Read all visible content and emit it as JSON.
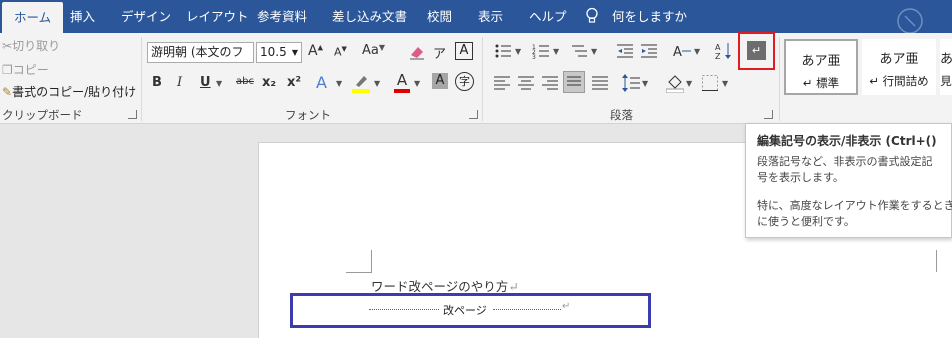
{
  "tabs": [
    {
      "label": "ホーム",
      "active": true
    },
    {
      "label": "挿入"
    },
    {
      "label": "デザイン"
    },
    {
      "label": "レイアウト"
    },
    {
      "label": "参考資料"
    },
    {
      "label": "差し込み文書"
    },
    {
      "label": "校閲"
    },
    {
      "label": "表示"
    },
    {
      "label": "ヘルプ"
    }
  ],
  "tell_me": "何をしますか",
  "clipboard": {
    "cut": "切り取り",
    "copy": "コピー",
    "format_painter": "書式のコピー/貼り付け",
    "label": "クリップボード"
  },
  "font": {
    "name": "游明朝 (本文のフォ",
    "size": "10.5",
    "change_case": "Aa",
    "label": "フォント",
    "bold": "B",
    "italic": "I",
    "underline": "U",
    "strike": "abc",
    "sub": "x₂",
    "sup": "x²",
    "grow": "A",
    "shrink": "A",
    "effects": "A",
    "color": "A",
    "shade": "A",
    "border": "A",
    "enclose": "字"
  },
  "paragraph": {
    "label": "段落",
    "show_marks_symbol": "↵"
  },
  "styles": [
    {
      "preview": "あア亜",
      "name": "↵ 標準"
    },
    {
      "preview": "あア亜",
      "name": "↵ 行間詰め"
    },
    {
      "preview": "あ",
      "name": "見"
    }
  ],
  "tooltip": {
    "title": "編集記号の表示/非表示 (Ctrl+()",
    "line1": "段落記号など、非表示の書式設定記",
    "line2": "号を表示します。",
    "line3": "特に、高度なレイアウト作業をするとき",
    "line4": "に使うと便利です。"
  },
  "document": {
    "line1": "ワード改ページのやり方",
    "page_break": "改ページ",
    "para_mark": "↵"
  },
  "colors": {
    "tabbar": "#2b579a",
    "highlight_box": "#e01b24",
    "annotation_box": "#3c3caf",
    "highlight_yellow": "#ffff00",
    "font_red": "#e00000"
  }
}
